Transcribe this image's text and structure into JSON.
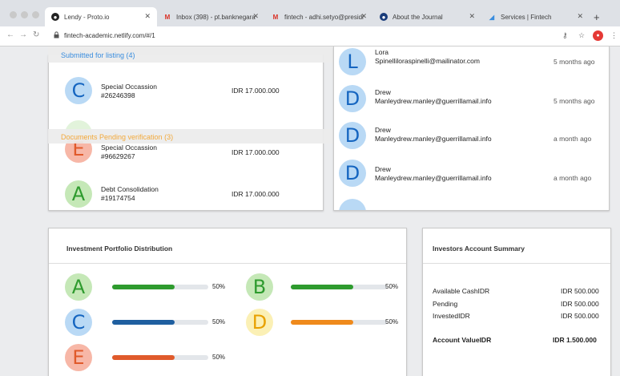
{
  "browser": {
    "tabs": [
      {
        "title": "Lendy - Proto.io",
        "icon": "proto-icon"
      },
      {
        "title": "Inbox (398) - pt.banknegara",
        "icon": "gmail-icon"
      },
      {
        "title": "fintech - adhi.setyo@presidi",
        "icon": "gmail-icon"
      },
      {
        "title": "About the Journal",
        "icon": "journal-icon"
      },
      {
        "title": "Services | Fintech",
        "icon": "fintech-icon"
      }
    ],
    "url": "fintech-academic.netlify.com/#/1"
  },
  "listing": {
    "submitted_label": "Submitted for listing (4)",
    "pending_label": "Documents Pending verification (3)",
    "items": [
      {
        "letter": "C",
        "name": "Special Occassion",
        "id": "#26246398",
        "amount": "IDR 17.000.000"
      },
      {
        "letter": "E",
        "name": "Special Occassion",
        "id": "#96629267",
        "amount": "IDR 17.000.000"
      },
      {
        "letter": "A",
        "name": "Debt Consolidation",
        "id": "#19174754",
        "amount": "IDR 17.000.000"
      }
    ]
  },
  "users": {
    "items": [
      {
        "letter": "L",
        "name": "Lora",
        "email": "Spinelliloraspinelli@mailinator.com",
        "time": "5 months ago"
      },
      {
        "letter": "D",
        "name": "Drew",
        "email": "Manleydrew.manley@guerrillamail.info",
        "time": "5 months ago"
      },
      {
        "letter": "D",
        "name": "Drew",
        "email": "Manleydrew.manley@guerrillamail.info",
        "time": "a month ago"
      },
      {
        "letter": "D",
        "name": "Drew",
        "email": "Manleydrew.manley@guerrillamail.info",
        "time": "a month ago"
      }
    ]
  },
  "portfolio": {
    "title": "Investment Portfolio Distribution",
    "items": [
      {
        "letter": "A",
        "label": "50%",
        "value": 0.5,
        "color": "#2e9b2e"
      },
      {
        "letter": "B",
        "label": "50%",
        "value": 0.5,
        "color": "#2e9b2e"
      },
      {
        "letter": "C",
        "label": "50%",
        "value": 0.5,
        "color": "#1f5fa0"
      },
      {
        "letter": "D",
        "label": "50%",
        "value": 0.5,
        "color": "#ef8a1c"
      },
      {
        "letter": "E",
        "label": "50%",
        "value": 0.5,
        "color": "#e05a2b"
      }
    ]
  },
  "summary": {
    "title": "Investors Account Summary",
    "rows": [
      {
        "label": "Available CashIDR",
        "value": "IDR 500.000"
      },
      {
        "label": "Pending",
        "value": "IDR 500.000"
      },
      {
        "label": "InvestedIDR",
        "value": "IDR 500.000"
      }
    ],
    "total_label": "Account ValueIDR",
    "total_value": "IDR 1.500.000"
  }
}
